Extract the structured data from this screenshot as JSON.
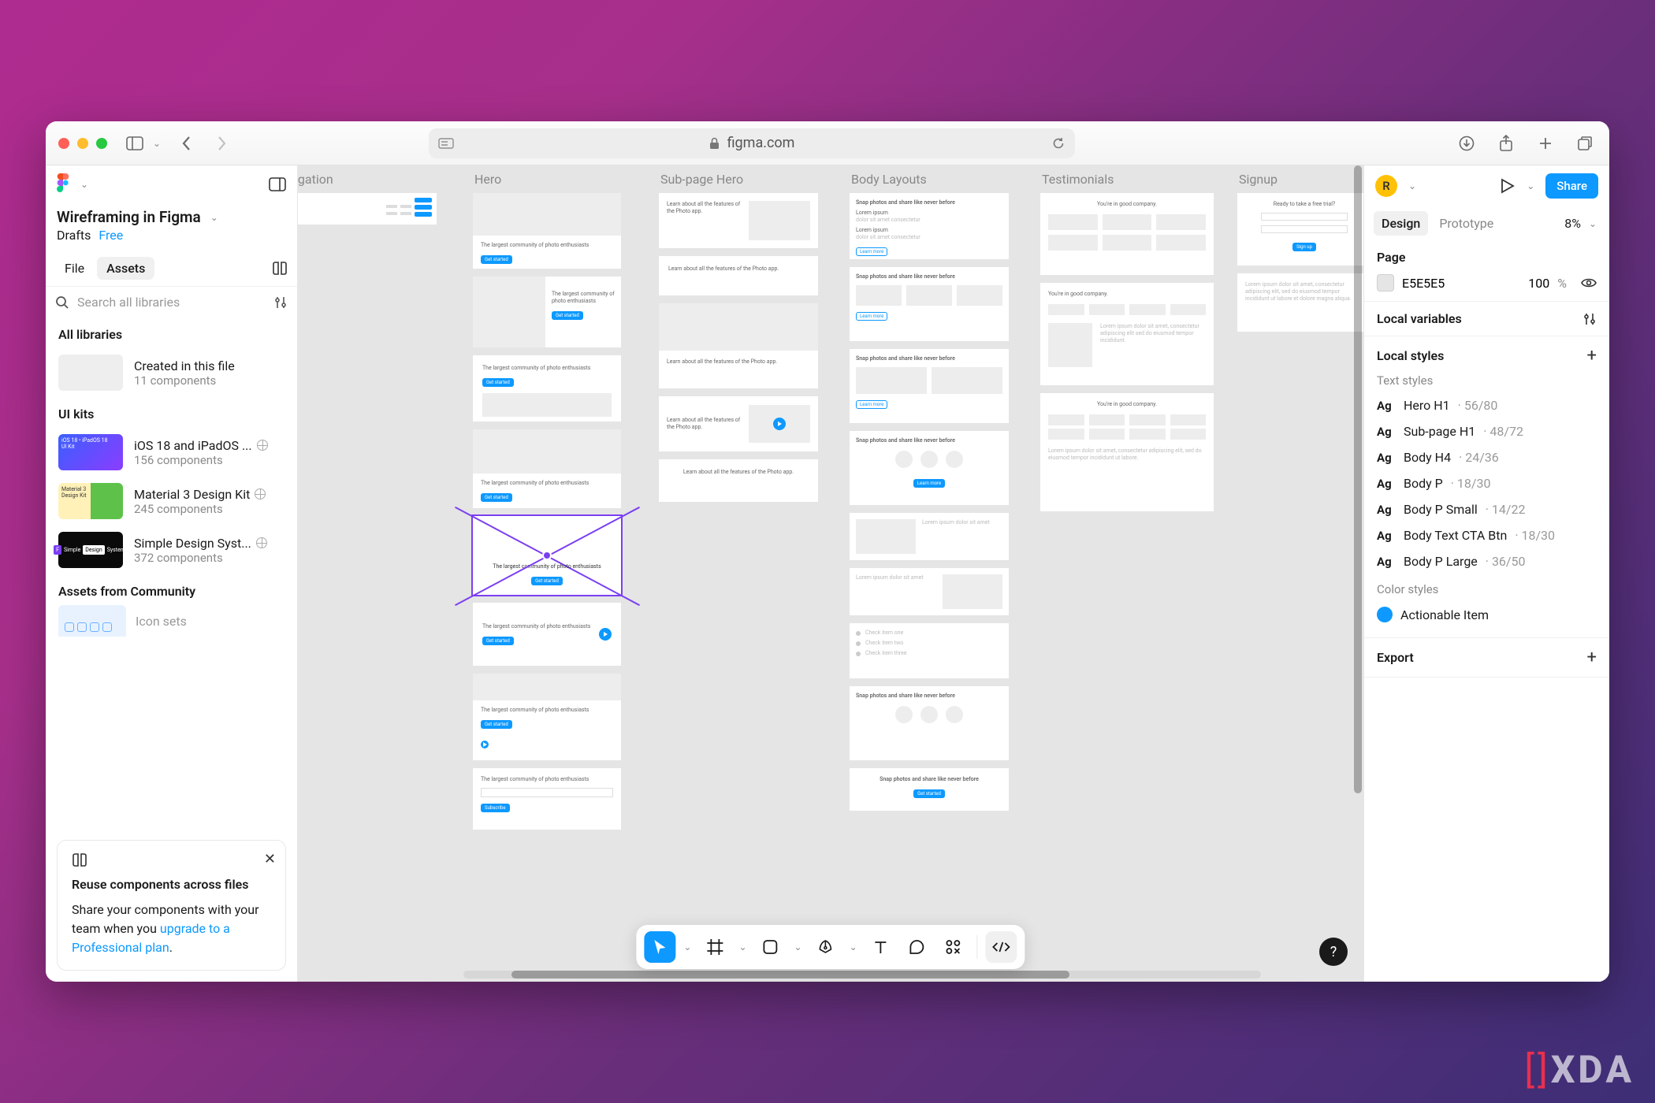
{
  "browser": {
    "domain": "figma.com"
  },
  "left_panel": {
    "file_title": "Wireframing in Figma",
    "breadcrumb": {
      "drafts": "Drafts",
      "free": "Free"
    },
    "tabs": {
      "file": "File",
      "assets": "Assets"
    },
    "search_placeholder": "Search all libraries",
    "all_libraries_label": "All libraries",
    "created": {
      "name": "Created in this file",
      "sub": "11 components"
    },
    "ui_kits_label": "UI kits",
    "kits": [
      {
        "name": "iOS 18 and iPadOS ...",
        "sub": "156 components"
      },
      {
        "name": "Material 3 Design Kit",
        "sub": "245 components"
      },
      {
        "name": "Simple Design Syst...",
        "sub": "372 components"
      }
    ],
    "community_label": "Assets from Community",
    "community_item": "Icon sets",
    "tip": {
      "title": "Reuse components across files",
      "body_prefix": "Share your components with your team when you ",
      "link": "upgrade to a Professional plan",
      "body_suffix": "."
    }
  },
  "canvas": {
    "sections": {
      "navigation": "igation",
      "hero": "Hero",
      "subhero": "Sub-page Hero",
      "body": "Body Layouts",
      "testimonials": "Testimonials",
      "signup": "Signup"
    },
    "hero_copy": "The largest community of photo enthusiasts",
    "hero_selected": "The largest community of photo enthusiasts",
    "subhero_copy": "Learn about all the features of the Photo app.",
    "body_copy": "Snap photos and share like never before",
    "testi_copy": "You're in good company.",
    "signup_copy": "Ready to take a free trial?"
  },
  "right_panel": {
    "avatar": "R",
    "share": "Share",
    "tabs": {
      "design": "Design",
      "prototype": "Prototype"
    },
    "zoom": "8%",
    "page_label": "Page",
    "page_color": "E5E5E5",
    "page_opacity": "100",
    "page_unit": "%",
    "local_vars": "Local variables",
    "local_styles": "Local styles",
    "text_styles_label": "Text styles",
    "text_styles": [
      {
        "name": "Hero H1",
        "meta": "56/80"
      },
      {
        "name": "Sub-page H1",
        "meta": "48/72"
      },
      {
        "name": "Body H4",
        "meta": "24/36"
      },
      {
        "name": "Body P",
        "meta": "18/30"
      },
      {
        "name": "Body P Small",
        "meta": "14/22"
      },
      {
        "name": "Body Text CTA Btn",
        "meta": "18/30"
      },
      {
        "name": "Body P Large",
        "meta": "36/50"
      }
    ],
    "color_styles_label": "Color styles",
    "color_style": "Actionable Item",
    "export": "Export"
  },
  "watermark": "XDA"
}
